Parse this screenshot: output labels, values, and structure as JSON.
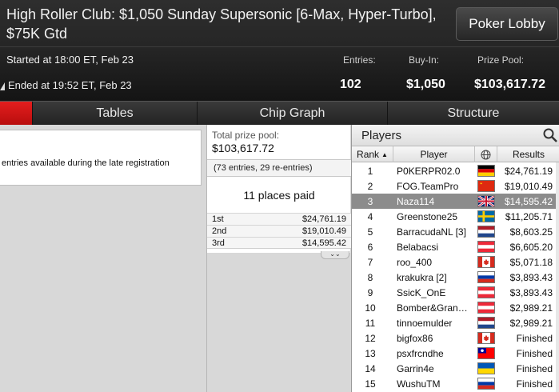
{
  "header": {
    "title": "High Roller Club: $1,050 Sunday Supersonic [6-Max, Hyper-Turbo], $75K Gtd",
    "lobby_button": "Poker Lobby",
    "started": "Started at 18:00 ET, Feb 23",
    "ended": "Ended at 19:52 ET, Feb 23",
    "stats": {
      "entries_label": "Entries:",
      "entries_value": "102",
      "buyin_label": "Buy-In:",
      "buyin_value": "$1,050",
      "prizepool_label": "Prize Pool:",
      "prizepool_value": "$103,617.72"
    }
  },
  "tabs": [
    "Tables",
    "Chip Graph",
    "Structure"
  ],
  "left": {
    "note": "entries available during the late registration"
  },
  "prize": {
    "total_label": "Total prize pool:",
    "total_value": "$103,617.72",
    "entries_note": "(73 entries, 29 re-entries)",
    "places_paid": "11 places paid",
    "rows": [
      {
        "place": "1st",
        "amount": "$24,761.19"
      },
      {
        "place": "2nd",
        "amount": "$19,010.49"
      },
      {
        "place": "3rd",
        "amount": "$14,595.42"
      }
    ]
  },
  "players": {
    "title": "Players",
    "columns": {
      "rank": "Rank",
      "player": "Player",
      "results": "Results"
    },
    "rows": [
      {
        "rank": "1",
        "name": "P0KERPR02.0",
        "flag": "de",
        "result": "$24,761.19"
      },
      {
        "rank": "2",
        "name": "FOG.TeamPro",
        "flag": "cn",
        "result": "$19,010.49"
      },
      {
        "rank": "3",
        "name": "Naza114",
        "flag": "gb",
        "result": "$14,595.42",
        "selected": true
      },
      {
        "rank": "4",
        "name": "Greenstone25",
        "flag": "se",
        "result": "$11,205.71"
      },
      {
        "rank": "5",
        "name": "BarracudaNL [3]",
        "flag": "nl",
        "result": "$8,603.25"
      },
      {
        "rank": "6",
        "name": "Belabacsi",
        "flag": "at",
        "result": "$6,605.20"
      },
      {
        "rank": "7",
        "name": "roo_400",
        "flag": "ca",
        "result": "$5,071.18"
      },
      {
        "rank": "8",
        "name": "krakukra [2]",
        "flag": "ru",
        "result": "$3,893.43"
      },
      {
        "rank": "9",
        "name": "SsicK_OnE",
        "flag": "at",
        "result": "$3,893.43"
      },
      {
        "rank": "10",
        "name": "Bomber&Gran…",
        "flag": "at",
        "result": "$2,989.21"
      },
      {
        "rank": "11",
        "name": "tinnoemulder",
        "flag": "nl",
        "result": "$2,989.21"
      },
      {
        "rank": "12",
        "name": "bigfox86",
        "flag": "ca",
        "result": "Finished"
      },
      {
        "rank": "13",
        "name": "psxfrcndhe",
        "flag": "tw",
        "result": "Finished"
      },
      {
        "rank": "14",
        "name": "Garrin4e",
        "flag": "ua",
        "result": "Finished"
      },
      {
        "rank": "15",
        "name": "WushuTM",
        "flag": "ru",
        "result": "Finished"
      }
    ]
  },
  "colors": {
    "accent_red": "#d41515",
    "selected_row": "#8c8c8c",
    "header_dark": "#1f1f1f"
  }
}
